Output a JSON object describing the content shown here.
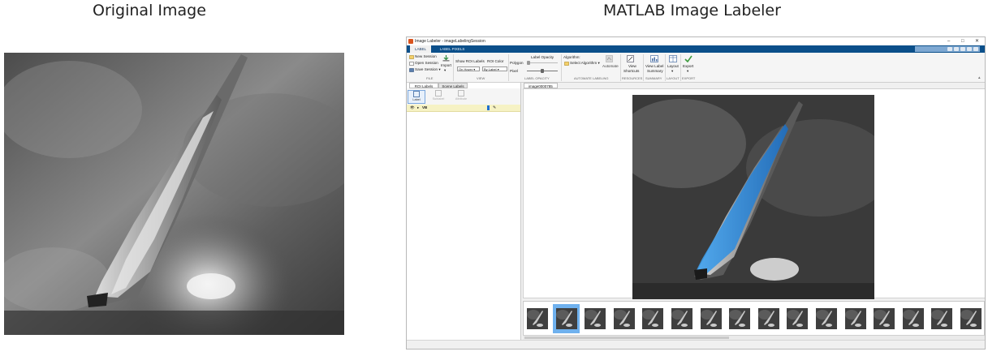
{
  "captions": {
    "left": "Original Image",
    "right": "MATLAB Image Labeler"
  },
  "window": {
    "title": "Image Labeler - imageLabelingSession",
    "controls": {
      "minimize": "–",
      "maximize": "□",
      "close": "✕"
    }
  },
  "tabs": [
    {
      "label": "LABEL"
    },
    {
      "label": "LABEL PIXELS"
    }
  ],
  "ribbon": {
    "file": {
      "new_session": "New Session",
      "open_session": "Open Session",
      "save_session": "Save Session ▾",
      "import": "Import",
      "section": "FILE"
    },
    "view": {
      "show_roi_labels": "Show ROI Labels",
      "show_roi_value": "On Hover",
      "roi_color": "ROI Color",
      "roi_color_value": "By Label",
      "section": "VIEW"
    },
    "label_opacity": {
      "polygon": "Polygon",
      "title": "Label Opacity",
      "pixel": "Pixel",
      "section": "LABEL OPACITY",
      "polygon_level": 0.0,
      "pixel_level": 0.5
    },
    "automate": {
      "algorithm_title": "Algorithm:",
      "select_algorithm": "Select Algorithm ▾",
      "automate": "Automate",
      "section": "AUTOMATE LABELING"
    },
    "resources": {
      "view": "View",
      "shortcuts": "Shortcuts",
      "section": "RESOURCES"
    },
    "summary": {
      "line1": "View Label",
      "line2": "Summary",
      "section": "SUMMARY"
    },
    "layout": {
      "label": "Layout",
      "section": "LAYOUT"
    },
    "export": {
      "label": "Export",
      "section": "EXPORT"
    }
  },
  "left_panel": {
    "tabs": [
      "ROI Labels",
      "Scene Labels"
    ],
    "tools": [
      "Label",
      "Sublabel",
      "Attribute"
    ],
    "roi_label": {
      "name": "VB",
      "color": "#1f6fd0"
    }
  },
  "document_tab": "image0000785",
  "filmstrip": {
    "count": 16,
    "selected_index": 1
  },
  "colors": {
    "accent": "#0b4f8a",
    "mask": "#2a8fe0",
    "selection": "#6fb1ee",
    "roi_row": "#f6f2c4"
  }
}
